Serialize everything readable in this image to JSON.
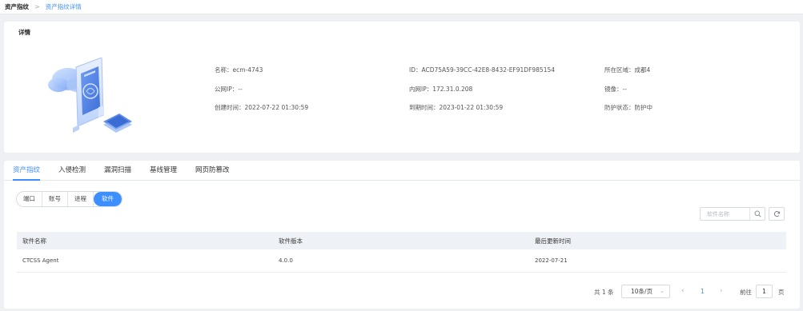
{
  "breadcrumb": {
    "root": "资产指纹",
    "separator": ">",
    "current": "资产指纹详情"
  },
  "detail": {
    "title": "详情",
    "fields": {
      "name": "名称：ecm-4743",
      "id": "ID：ACD75A59-39CC-42E8-8432-EF91DF985154",
      "region": "所在区域：成都4",
      "public_ip": "公网IP：--",
      "private_ip": "内网IP：172.31.0.208",
      "image": "镜像：--",
      "created": "创建时间：2022-07-22 01:30:59",
      "expires": "到期时间：2023-01-22 01:30:59",
      "protection": "防护状态：防护中"
    }
  },
  "tabs": [
    {
      "label": "资产指纹",
      "active": true
    },
    {
      "label": "入侵检测",
      "active": false
    },
    {
      "label": "漏洞扫描",
      "active": false
    },
    {
      "label": "基线管理",
      "active": false
    },
    {
      "label": "网页防篡改",
      "active": false
    }
  ],
  "segments": [
    {
      "label": "端口",
      "active": false
    },
    {
      "label": "账号",
      "active": false
    },
    {
      "label": "进程",
      "active": false
    },
    {
      "label": "软件",
      "active": true
    }
  ],
  "search": {
    "placeholder": "软件名称",
    "icon": "search-icon",
    "refresh_icon": "refresh-icon"
  },
  "table": {
    "columns": [
      "软件名称",
      "软件版本",
      "最后更新时间"
    ],
    "rows": [
      [
        "CTCSS Agent",
        "4.0.0",
        "2022-07-21"
      ]
    ]
  },
  "pagination": {
    "total": "共 1 条",
    "page_size": "10条/页",
    "current_page": "1",
    "goto_label": "前往",
    "goto_value": "1",
    "goto_unit": "页"
  },
  "colors": {
    "accent": "#3d8fff",
    "background": "#eef0f3",
    "header_bg": "#eef1f5"
  }
}
